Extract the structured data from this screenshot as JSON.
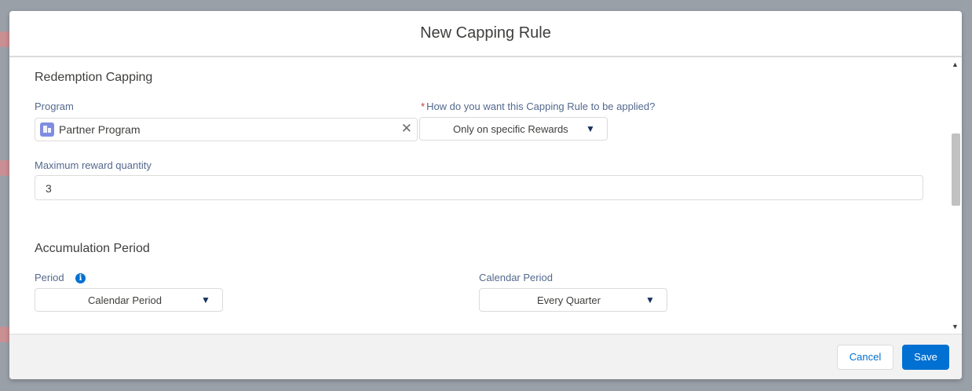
{
  "modal": {
    "title": "New Capping Rule"
  },
  "redemption_section": {
    "title": "Redemption Capping",
    "program_label": "Program",
    "program_value": "Partner Program",
    "applied_label": "How do you want this Capping Rule to be applied?",
    "applied_required_marker": "*",
    "applied_value": "Only on specific Rewards",
    "max_qty_label": "Maximum reward quantity",
    "max_qty_value": "3"
  },
  "accumulation_section": {
    "title": "Accumulation Period",
    "period_label": "Period",
    "period_value": "Calendar Period",
    "calendar_period_label": "Calendar Period",
    "calendar_period_value": "Every Quarter"
  },
  "footer": {
    "cancel_label": "Cancel",
    "save_label": "Save"
  },
  "icons": {
    "program": "program-icon",
    "clear": "close-icon",
    "dropdown": "chevron-down-icon",
    "info": "info-icon"
  },
  "colors": {
    "brand": "#0070d2",
    "label": "#54698d",
    "required": "#c23934"
  }
}
